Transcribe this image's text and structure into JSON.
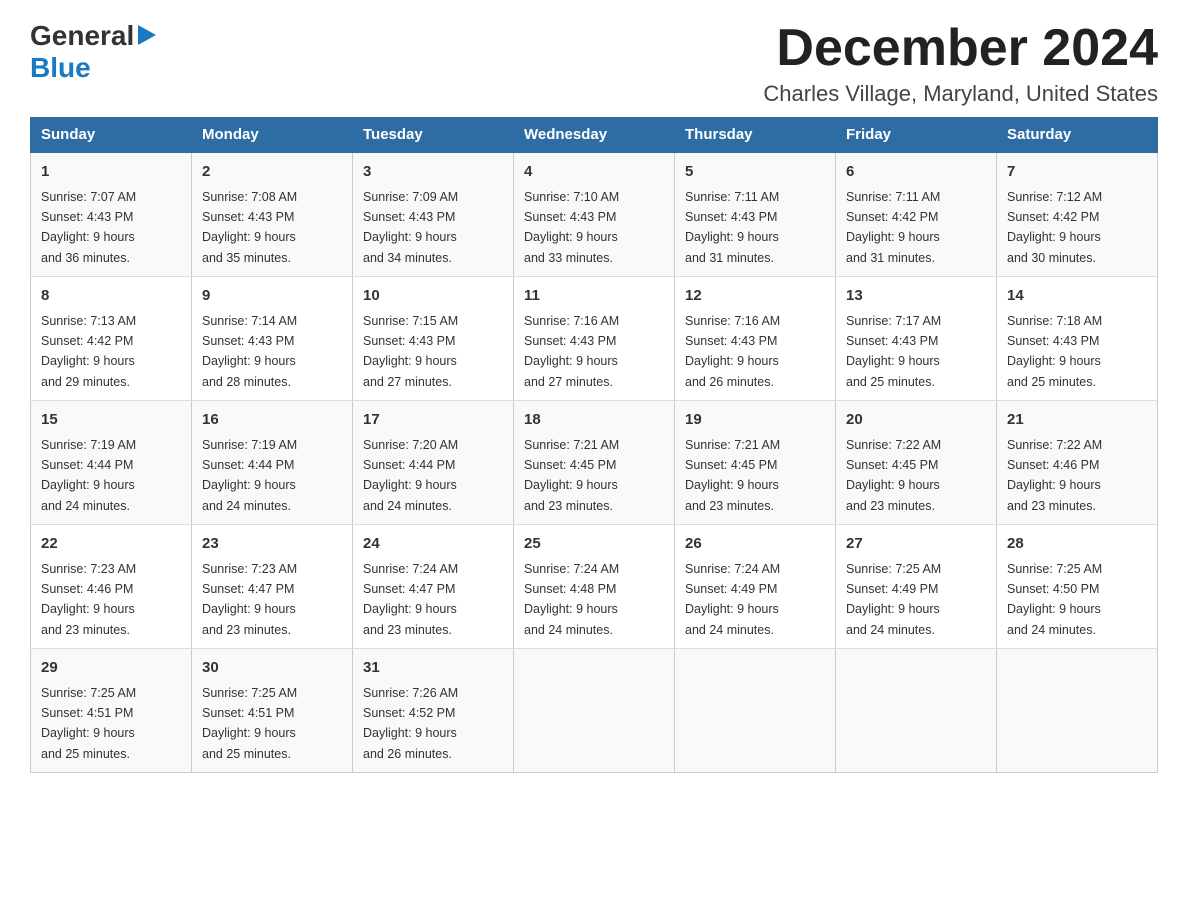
{
  "logo": {
    "general_text": "General",
    "blue_text": "Blue"
  },
  "title": {
    "month_year": "December 2024",
    "location": "Charles Village, Maryland, United States"
  },
  "days_of_week": [
    "Sunday",
    "Monday",
    "Tuesday",
    "Wednesday",
    "Thursday",
    "Friday",
    "Saturday"
  ],
  "weeks": [
    [
      {
        "day": "1",
        "sunrise": "7:07 AM",
        "sunset": "4:43 PM",
        "daylight": "9 hours and 36 minutes."
      },
      {
        "day": "2",
        "sunrise": "7:08 AM",
        "sunset": "4:43 PM",
        "daylight": "9 hours and 35 minutes."
      },
      {
        "day": "3",
        "sunrise": "7:09 AM",
        "sunset": "4:43 PM",
        "daylight": "9 hours and 34 minutes."
      },
      {
        "day": "4",
        "sunrise": "7:10 AM",
        "sunset": "4:43 PM",
        "daylight": "9 hours and 33 minutes."
      },
      {
        "day": "5",
        "sunrise": "7:11 AM",
        "sunset": "4:43 PM",
        "daylight": "9 hours and 31 minutes."
      },
      {
        "day": "6",
        "sunrise": "7:11 AM",
        "sunset": "4:42 PM",
        "daylight": "9 hours and 31 minutes."
      },
      {
        "day": "7",
        "sunrise": "7:12 AM",
        "sunset": "4:42 PM",
        "daylight": "9 hours and 30 minutes."
      }
    ],
    [
      {
        "day": "8",
        "sunrise": "7:13 AM",
        "sunset": "4:42 PM",
        "daylight": "9 hours and 29 minutes."
      },
      {
        "day": "9",
        "sunrise": "7:14 AM",
        "sunset": "4:43 PM",
        "daylight": "9 hours and 28 minutes."
      },
      {
        "day": "10",
        "sunrise": "7:15 AM",
        "sunset": "4:43 PM",
        "daylight": "9 hours and 27 minutes."
      },
      {
        "day": "11",
        "sunrise": "7:16 AM",
        "sunset": "4:43 PM",
        "daylight": "9 hours and 27 minutes."
      },
      {
        "day": "12",
        "sunrise": "7:16 AM",
        "sunset": "4:43 PM",
        "daylight": "9 hours and 26 minutes."
      },
      {
        "day": "13",
        "sunrise": "7:17 AM",
        "sunset": "4:43 PM",
        "daylight": "9 hours and 25 minutes."
      },
      {
        "day": "14",
        "sunrise": "7:18 AM",
        "sunset": "4:43 PM",
        "daylight": "9 hours and 25 minutes."
      }
    ],
    [
      {
        "day": "15",
        "sunrise": "7:19 AM",
        "sunset": "4:44 PM",
        "daylight": "9 hours and 24 minutes."
      },
      {
        "day": "16",
        "sunrise": "7:19 AM",
        "sunset": "4:44 PM",
        "daylight": "9 hours and 24 minutes."
      },
      {
        "day": "17",
        "sunrise": "7:20 AM",
        "sunset": "4:44 PM",
        "daylight": "9 hours and 24 minutes."
      },
      {
        "day": "18",
        "sunrise": "7:21 AM",
        "sunset": "4:45 PM",
        "daylight": "9 hours and 23 minutes."
      },
      {
        "day": "19",
        "sunrise": "7:21 AM",
        "sunset": "4:45 PM",
        "daylight": "9 hours and 23 minutes."
      },
      {
        "day": "20",
        "sunrise": "7:22 AM",
        "sunset": "4:45 PM",
        "daylight": "9 hours and 23 minutes."
      },
      {
        "day": "21",
        "sunrise": "7:22 AM",
        "sunset": "4:46 PM",
        "daylight": "9 hours and 23 minutes."
      }
    ],
    [
      {
        "day": "22",
        "sunrise": "7:23 AM",
        "sunset": "4:46 PM",
        "daylight": "9 hours and 23 minutes."
      },
      {
        "day": "23",
        "sunrise": "7:23 AM",
        "sunset": "4:47 PM",
        "daylight": "9 hours and 23 minutes."
      },
      {
        "day": "24",
        "sunrise": "7:24 AM",
        "sunset": "4:47 PM",
        "daylight": "9 hours and 23 minutes."
      },
      {
        "day": "25",
        "sunrise": "7:24 AM",
        "sunset": "4:48 PM",
        "daylight": "9 hours and 24 minutes."
      },
      {
        "day": "26",
        "sunrise": "7:24 AM",
        "sunset": "4:49 PM",
        "daylight": "9 hours and 24 minutes."
      },
      {
        "day": "27",
        "sunrise": "7:25 AM",
        "sunset": "4:49 PM",
        "daylight": "9 hours and 24 minutes."
      },
      {
        "day": "28",
        "sunrise": "7:25 AM",
        "sunset": "4:50 PM",
        "daylight": "9 hours and 24 minutes."
      }
    ],
    [
      {
        "day": "29",
        "sunrise": "7:25 AM",
        "sunset": "4:51 PM",
        "daylight": "9 hours and 25 minutes."
      },
      {
        "day": "30",
        "sunrise": "7:25 AM",
        "sunset": "4:51 PM",
        "daylight": "9 hours and 25 minutes."
      },
      {
        "day": "31",
        "sunrise": "7:26 AM",
        "sunset": "4:52 PM",
        "daylight": "9 hours and 26 minutes."
      },
      null,
      null,
      null,
      null
    ]
  ],
  "labels": {
    "sunrise": "Sunrise:",
    "sunset": "Sunset:",
    "daylight": "Daylight:"
  }
}
